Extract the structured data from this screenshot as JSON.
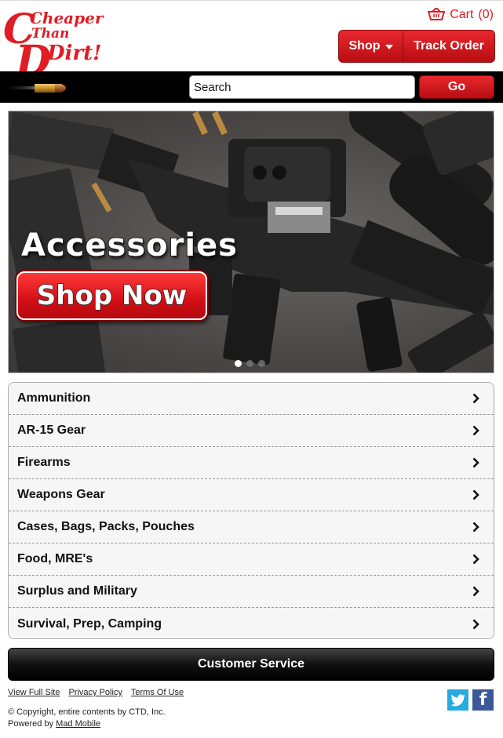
{
  "header": {
    "logo": {
      "line1": "Cheaper",
      "line2": "Than",
      "line3": "Dirt!",
      "icon": "cheaper-than-dirt-logo"
    },
    "cart": {
      "label": "Cart",
      "count": "(0)",
      "icon": "cart-icon"
    },
    "nav": {
      "shop_label": "Shop",
      "track_label": "Track Order"
    }
  },
  "search": {
    "placeholder": "Search",
    "value": "",
    "go_label": "Go"
  },
  "banner": {
    "title": "Accessories",
    "cta": "Shop Now",
    "slides": 3,
    "active_slide": 1
  },
  "categories": [
    "Ammunition",
    "AR-15 Gear",
    "Firearms",
    "Weapons Gear",
    "Cases, Bags, Packs, Pouches",
    "Food, MRE's",
    "Surplus and Military",
    "Survival, Prep, Camping"
  ],
  "customer_service": "Customer Service",
  "footer": {
    "links": [
      "View Full Site",
      "Privacy Policy",
      "Terms Of Use"
    ],
    "copyright": "© Copyright, entire contents by CTD, Inc.",
    "powered_prefix": "Powered by",
    "powered_link": "Mad Mobile",
    "social": [
      "twitter-icon",
      "facebook-icon"
    ]
  },
  "colors": {
    "brand_red": "#e01c24",
    "button_red": "#c8141a",
    "twitter": "#29a9e1",
    "facebook": "#3b5998"
  }
}
